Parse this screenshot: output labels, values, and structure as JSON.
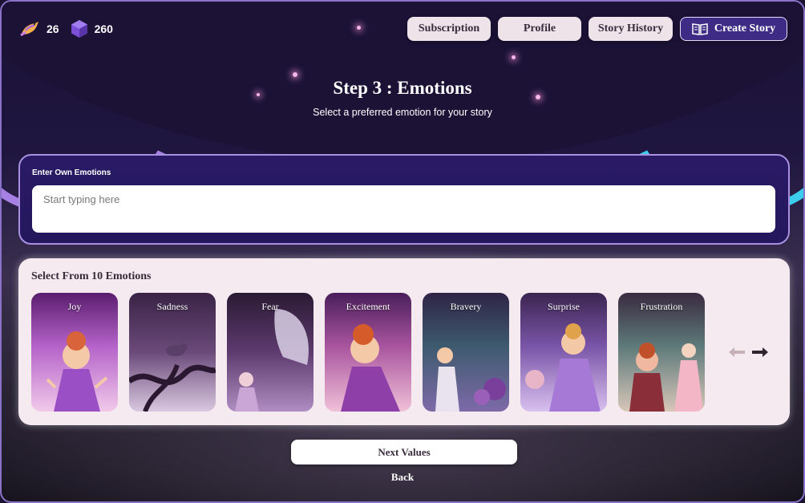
{
  "stats": {
    "feathers": "26",
    "gems": "260",
    "feather_icon": "bird-icon",
    "gem_icon": "gem-icon"
  },
  "nav": {
    "subscription": "Subscription",
    "profile": "Profile",
    "story_history": "Story History",
    "create_story": "Create Story",
    "create_icon": "book-icon"
  },
  "header": {
    "title": "Step 3 : Emotions",
    "subtitle": "Select a preferred emotion for your story"
  },
  "own_emotions": {
    "label": "Enter Own Emotions",
    "placeholder": "Start typing here",
    "value": ""
  },
  "emotions": {
    "title": "Select From 10 Emotions",
    "cards": [
      {
        "label": "Joy"
      },
      {
        "label": "Sadness"
      },
      {
        "label": "Fear"
      },
      {
        "label": "Excitement"
      },
      {
        "label": "Bravery"
      },
      {
        "label": "Surprise"
      },
      {
        "label": "Frustration"
      }
    ],
    "prev_icon": "arrow-left-icon",
    "next_icon": "arrow-right-icon"
  },
  "footer": {
    "next_values": "Next Values",
    "back": "Back"
  },
  "colors": {
    "accent_purple": "#3d2b86",
    "panel_purple": "#2a1a66",
    "panel_pink": "#f6eaf1",
    "arc_left": "#b48cf5",
    "arc_right": "#3fe0ff"
  }
}
